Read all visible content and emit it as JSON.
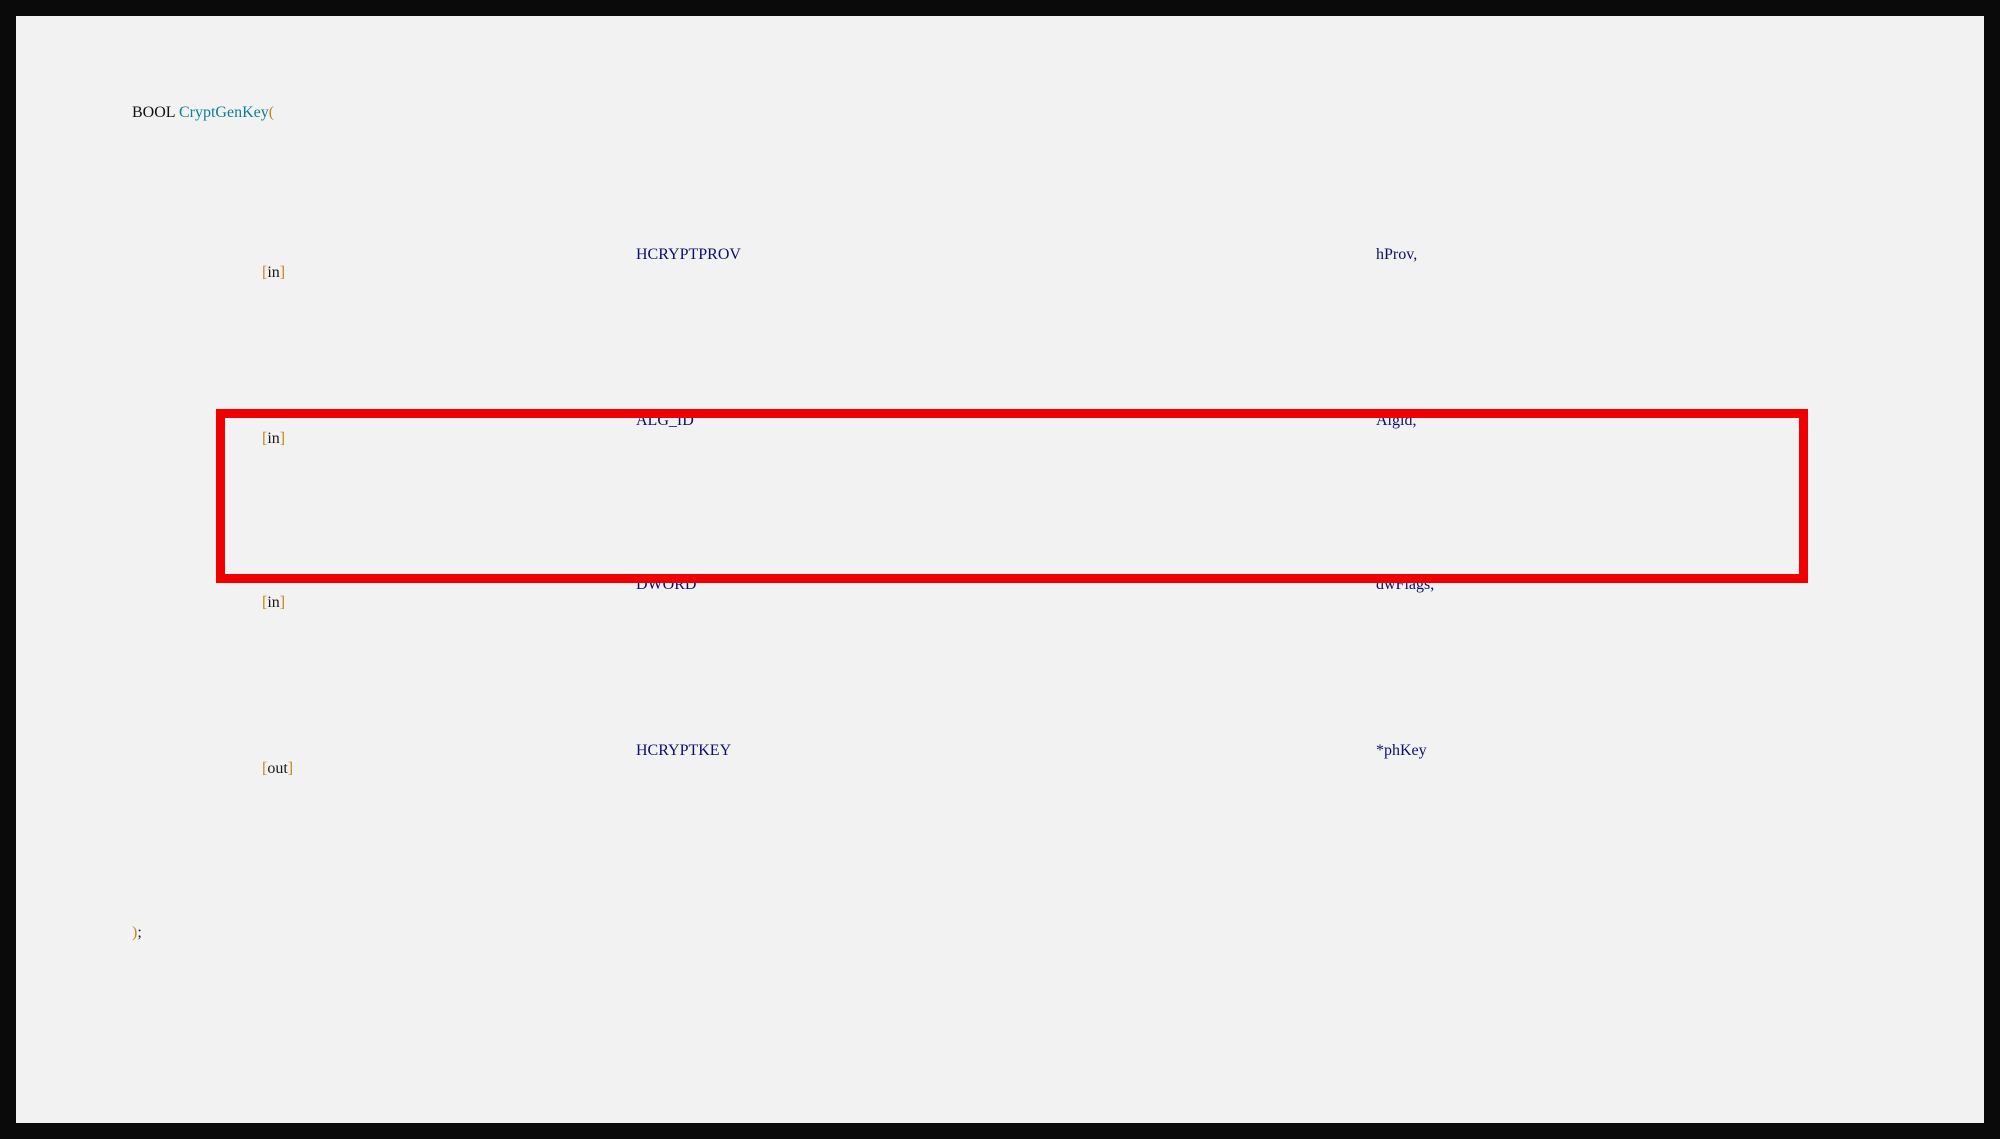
{
  "colors": {
    "border": "#0a0a0a",
    "background": "#f2f2f2",
    "function_name": "#0e7f91",
    "bracket": "#c8860a",
    "type": "#0b0e6b",
    "highlight_box": "#f00000"
  },
  "code": {
    "line1": {
      "keyword": "BOOL",
      "function": "CryptGenKey",
      "open_paren": "("
    },
    "params": [
      {
        "bracket_open": "[",
        "direction": "in",
        "bracket_close": "]",
        "type": "HCRYPTPROV",
        "name": "hProv,",
        "highlighted": false
      },
      {
        "bracket_open": "[",
        "direction": "in",
        "bracket_close": "]",
        "type": "ALG_ID",
        "name": "Algid,",
        "highlighted": true
      },
      {
        "bracket_open": "[",
        "direction": "in",
        "bracket_close": "]",
        "type": "DWORD",
        "name": "dwFlags,",
        "highlighted": false
      },
      {
        "bracket_open": "[",
        "direction": "out",
        "bracket_close": "]",
        "type": "HCRYPTKEY",
        "name": "*phKey",
        "highlighted": false
      }
    ],
    "closing": {
      "close_paren": ")",
      "semicolon": ";"
    }
  }
}
